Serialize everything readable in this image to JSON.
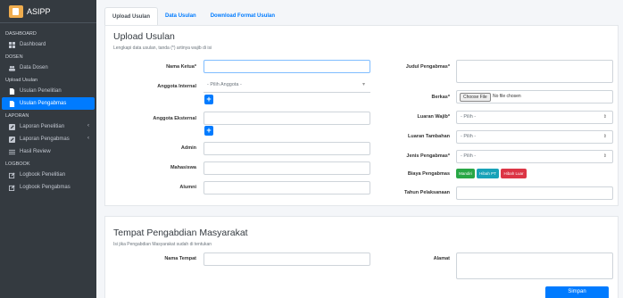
{
  "brand": {
    "name": "ASIPP"
  },
  "sidebar": {
    "sections": [
      {
        "header": "DASHBOARD",
        "items": [
          {
            "label": "Dashboard",
            "icon": "dashboard-icon"
          }
        ]
      },
      {
        "header": "DOSEN",
        "items": [
          {
            "label": "Data Dosen",
            "icon": "users-icon"
          }
        ]
      },
      {
        "header": "Upload Usulan",
        "items": [
          {
            "label": "Usulan Penelitian",
            "icon": "file-icon"
          },
          {
            "label": "Usulan Pengabmas",
            "icon": "file-icon",
            "active": true
          }
        ]
      },
      {
        "header": "LAPORAN",
        "items": [
          {
            "label": "Laporan Penelitian",
            "icon": "edit-icon"
          },
          {
            "label": "Laporan Pengabmas",
            "icon": "edit-icon"
          },
          {
            "label": "Hasil Review",
            "icon": "list-icon"
          }
        ]
      },
      {
        "header": "LOGBOOK",
        "items": [
          {
            "label": "Logbook Penelitian",
            "icon": "pencil-icon"
          },
          {
            "label": "Logbook Pengabmas",
            "icon": "pencil-icon"
          }
        ]
      }
    ]
  },
  "tabs": [
    "Upload Usulan",
    "Data Usulan",
    "Download Format Usulan"
  ],
  "upload": {
    "title": "Upload Usulan",
    "subtitle": "Lengkapi data usulan, tanda (*) artinya wajib di isi",
    "nama_ketua_label": "Nama Ketua*",
    "anggota_internal_label": "Anggota Internal",
    "anggota_internal_placeholder": "- Pilih Anggota -",
    "anggota_eksternal_label": "Anggota Eksternal",
    "admin_label": "Admin",
    "mahasiswa_label": "Mahasiswa",
    "alumni_label": "Alumni",
    "judul_label": "Judul Pengabmas*",
    "berkas_label": "Berkas*",
    "file_button": "Choose File",
    "file_status": "No file chosen",
    "luaran_wajib_label": "Luaran Wajib*",
    "luaran_tambahan_label": "Luaran Tambahan",
    "jenis_label": "Jenis Pengabmas*",
    "pilih": "- Pilih -",
    "biaya_label": "Biaya Pengabmas",
    "biaya_options": [
      {
        "label": "Mandiri",
        "color": "#28a745"
      },
      {
        "label": "Hibah PT",
        "color": "#17a2b8"
      },
      {
        "label": "Hibah Luar",
        "color": "#dc3545"
      }
    ],
    "tahun_label": "Tahun Pelaksanaan",
    "plus": "+"
  },
  "tempat": {
    "title": "Tempat Pengabdian Masyarakat",
    "subtitle": "Isi jika Pengabdian Masyarakat sudah di tentukan",
    "nama_tempat_label": "Nama Tempat",
    "alamat_label": "Alamat",
    "save": "Simpan"
  }
}
